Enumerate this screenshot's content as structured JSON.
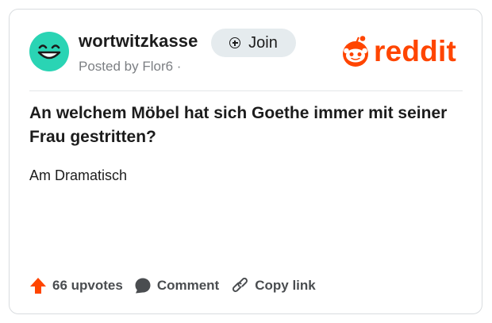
{
  "post": {
    "subreddit": "wortwitzkasse",
    "posted_by": "Posted by Flor6 ·",
    "join_label": "Join",
    "title": "An welchem Möbel hat sich Goethe immer mit seiner Frau gestritten?",
    "body": "Am Dramatisch"
  },
  "brand": {
    "wordmark": "reddit",
    "color": "#ff4500"
  },
  "avatar": {
    "icon": "smiley-face-icon",
    "color": "#2ad4b4"
  },
  "actions": {
    "upvotes_label": "66 upvotes",
    "comment_label": "Comment",
    "copy_link_label": "Copy link"
  }
}
